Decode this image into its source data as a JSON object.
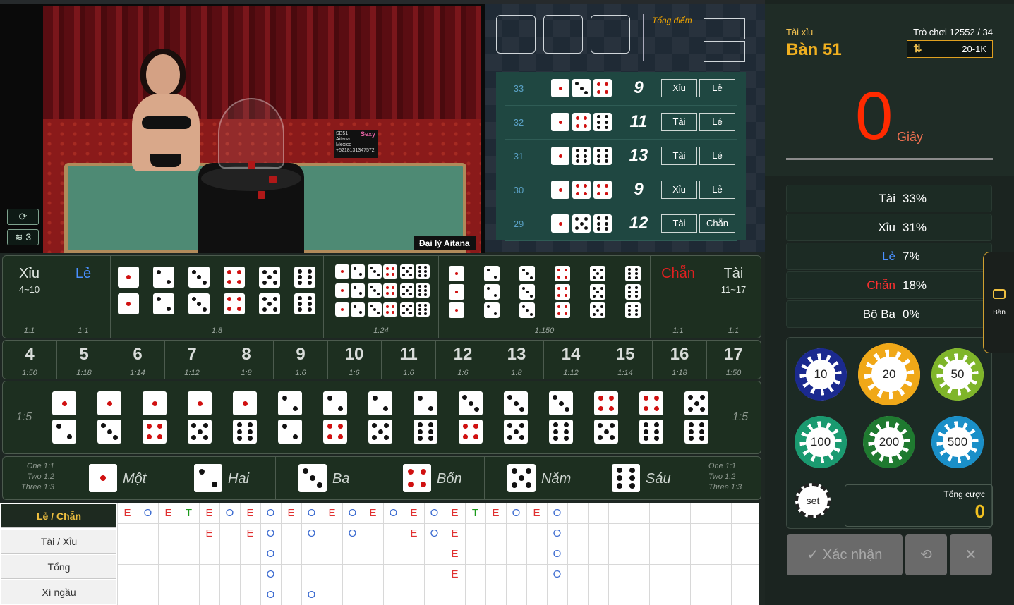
{
  "video": {
    "dealer_label": "Đại lý Aitana",
    "card_lines": [
      "SB51",
      "Aitana",
      "Mexico",
      "+5218131347572"
    ],
    "card_logo": "Sexy",
    "refresh_icon": "refresh-icon",
    "signal_icon": "wifi-icon",
    "signal_count": "3"
  },
  "results": {
    "total_label": "Tổng điểm",
    "history": [
      {
        "round": "33",
        "dice": [
          1,
          3,
          4
        ],
        "sum": "9",
        "tags": [
          "Xỉu",
          "Lẻ"
        ]
      },
      {
        "round": "32",
        "dice": [
          1,
          4,
          6
        ],
        "sum": "11",
        "tags": [
          "Tài",
          "Lẻ"
        ]
      },
      {
        "round": "31",
        "dice": [
          1,
          6,
          6
        ],
        "sum": "13",
        "tags": [
          "Tài",
          "Lẻ"
        ]
      },
      {
        "round": "30",
        "dice": [
          1,
          4,
          4
        ],
        "sum": "9",
        "tags": [
          "Xỉu",
          "Lẻ"
        ]
      },
      {
        "round": "29",
        "dice": [
          1,
          5,
          6
        ],
        "sum": "12",
        "tags": [
          "Tài",
          "Chẵn"
        ]
      }
    ]
  },
  "board": {
    "xiu": {
      "label": "Xỉu",
      "range": "4~10",
      "odds": "1:1"
    },
    "le": {
      "label": "Lẻ",
      "odds": "1:1"
    },
    "pairs_odds": "1:8",
    "any_triple_odds": "1:24",
    "triples_odds": "1:150",
    "chan": {
      "label": "Chẵn",
      "odds": "1:1"
    },
    "tai": {
      "label": "Tài",
      "range": "11~17",
      "odds": "1:1"
    },
    "sums": [
      {
        "v": "4",
        "o": "1:50"
      },
      {
        "v": "5",
        "o": "1:18"
      },
      {
        "v": "6",
        "o": "1:14"
      },
      {
        "v": "7",
        "o": "1:12"
      },
      {
        "v": "8",
        "o": "1:8"
      },
      {
        "v": "9",
        "o": "1:6"
      },
      {
        "v": "10",
        "o": "1:6"
      },
      {
        "v": "11",
        "o": "1:6"
      },
      {
        "v": "12",
        "o": "1:6"
      },
      {
        "v": "13",
        "o": "1:8"
      },
      {
        "v": "14",
        "o": "1:12"
      },
      {
        "v": "15",
        "o": "1:14"
      },
      {
        "v": "16",
        "o": "1:18"
      },
      {
        "v": "17",
        "o": "1:50"
      }
    ],
    "combo_odds": "1:5",
    "combos": [
      [
        1,
        2
      ],
      [
        1,
        3
      ],
      [
        1,
        4
      ],
      [
        1,
        5
      ],
      [
        1,
        6
      ],
      [
        2,
        2
      ],
      [
        2,
        4
      ],
      [
        2,
        5
      ],
      [
        2,
        6
      ],
      [
        3,
        4
      ],
      [
        3,
        5
      ],
      [
        3,
        6
      ],
      [
        4,
        5
      ],
      [
        4,
        6
      ],
      [
        5,
        6
      ]
    ],
    "singles": [
      "Một",
      "Hai",
      "Ba",
      "Bốn",
      "Năm",
      "Sáu"
    ],
    "single_odds": [
      "One 1:1",
      "Two 1:2",
      "Three 1:3"
    ]
  },
  "roadmap": {
    "tabs": [
      "Lẻ / Chẵn",
      "Tài / Xỉu",
      "Tổng",
      "Xí ngầu"
    ],
    "active_tab": 0,
    "columns": [
      [
        "E"
      ],
      [
        "O"
      ],
      [
        "E"
      ],
      [
        "T"
      ],
      [
        "E",
        "E"
      ],
      [
        "O"
      ],
      [
        "E",
        "E"
      ],
      [
        "O",
        "O",
        "O",
        "O",
        "O"
      ],
      [
        "E"
      ],
      [
        "O",
        "O",
        "",
        "",
        "O"
      ],
      [
        "E"
      ],
      [
        "O",
        "O"
      ],
      [
        "E"
      ],
      [
        "O"
      ],
      [
        "E",
        "E"
      ],
      [
        "O",
        "O"
      ],
      [
        "E",
        "E",
        "E",
        "E"
      ],
      [
        "T"
      ],
      [
        "E"
      ],
      [
        "O"
      ],
      [
        "E"
      ],
      [
        "O",
        "O",
        "O",
        "O"
      ]
    ]
  },
  "info": {
    "game_name": "Tài xỉu",
    "table_name": "Bàn 51",
    "round": "Trò chơi 12552 / 34",
    "limit": "20-1K",
    "timer": "0",
    "timer_unit": "Giây"
  },
  "stats": [
    {
      "label": "Tài",
      "pct": "33%",
      "color": "#ffffff"
    },
    {
      "label": "Xỉu",
      "pct": "31%",
      "color": "#ffffff"
    },
    {
      "label": "Lẻ",
      "pct": "7%",
      "color": "#4a90ff"
    },
    {
      "label": "Chẵn",
      "pct": "18%",
      "color": "#ff3030"
    },
    {
      "label": "Bộ Ba",
      "pct": "0%",
      "color": "#ffffff"
    }
  ],
  "chips": [
    {
      "v": "10",
      "color": "#1b2a8f"
    },
    {
      "v": "20",
      "color": "#f0a818"
    },
    {
      "v": "50",
      "color": "#7fb52a"
    },
    {
      "v": "100",
      "color": "#1a9a70"
    },
    {
      "v": "200",
      "color": "#1f7a30"
    },
    {
      "v": "500",
      "color": "#1a8fc8"
    }
  ],
  "set_chip": "set",
  "bet": {
    "label": "Tổng cược",
    "value": "0"
  },
  "actions": {
    "confirm": "Xác nhận"
  },
  "side_tab": "Bàn"
}
